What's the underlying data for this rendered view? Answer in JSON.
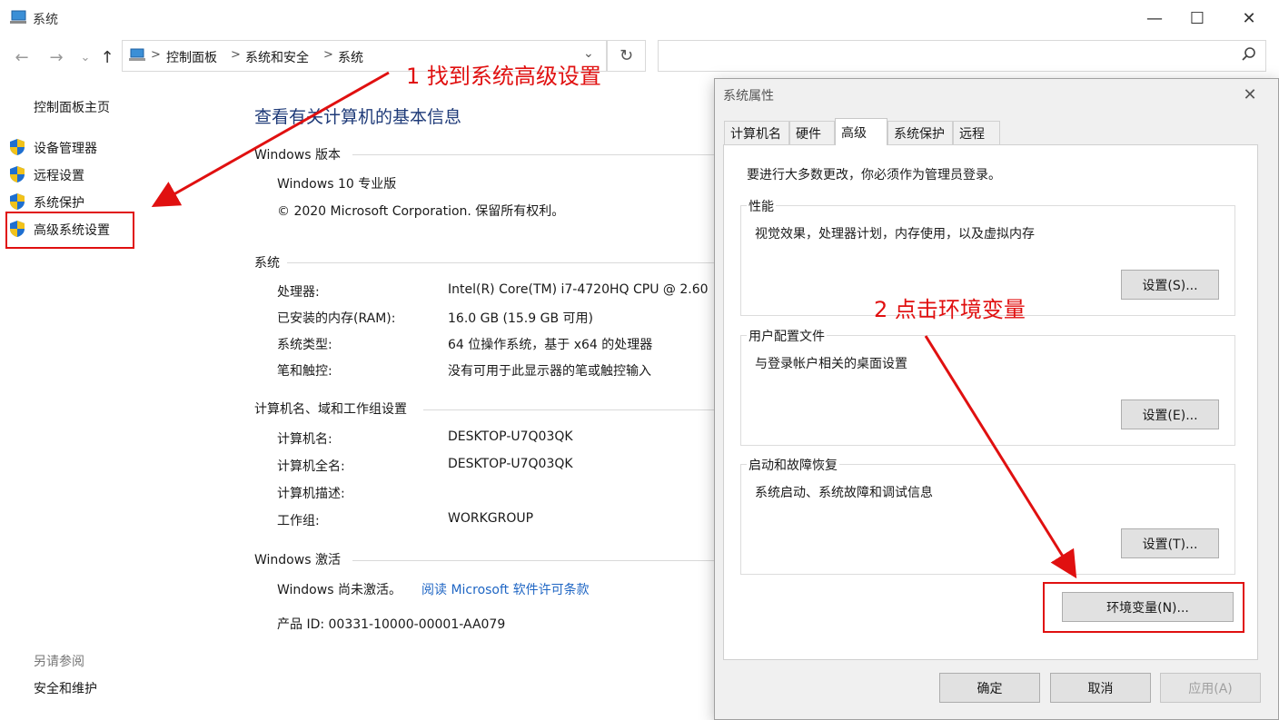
{
  "window": {
    "title": "系统",
    "controls": [
      "—",
      "☐",
      "✕"
    ]
  },
  "nav": {
    "back": "←",
    "forward": "→",
    "dropdown": "⌄",
    "up": "↑"
  },
  "breadcrumb": [
    "控制面板",
    "系统和安全",
    "系统"
  ],
  "breadcrumb_sep": ">",
  "address_dropdown": "⌄",
  "refresh": "↻",
  "sidebar": {
    "home": "控制面板主页",
    "items": [
      "设备管理器",
      "远程设置",
      "系统保护",
      "高级系统设置"
    ],
    "see_also_label": "另请参阅",
    "see_also": [
      "安全和维护"
    ]
  },
  "main": {
    "heading": "查看有关计算机的基本信息",
    "windows_edition": {
      "title": "Windows 版本",
      "edition": "Windows 10 专业版",
      "copyright": "© 2020 Microsoft Corporation. 保留所有权利。"
    },
    "system": {
      "title": "系统",
      "rows": [
        {
          "label": "处理器:",
          "value": "Intel(R) Core(TM) i7-4720HQ CPU @ 2.60"
        },
        {
          "label": "已安装的内存(RAM):",
          "value": "16.0 GB (15.9 GB 可用)"
        },
        {
          "label": "系统类型:",
          "value": "64 位操作系统，基于 x64 的处理器"
        },
        {
          "label": "笔和触控:",
          "value": "没有可用于此显示器的笔或触控输入"
        }
      ]
    },
    "computer": {
      "title": "计算机名、域和工作组设置",
      "rows": [
        {
          "label": "计算机名:",
          "value": "DESKTOP-U7Q03QK"
        },
        {
          "label": "计算机全名:",
          "value": "DESKTOP-U7Q03QK"
        },
        {
          "label": "计算机描述:",
          "value": ""
        },
        {
          "label": "工作组:",
          "value": "WORKGROUP"
        }
      ]
    },
    "activation": {
      "title": "Windows 激活",
      "status": "Windows 尚未激活。",
      "link": "阅读 Microsoft 软件许可条款",
      "product_id": "产品 ID: 00331-10000-00001-AA079"
    }
  },
  "dialog": {
    "title": "系统属性",
    "close": "✕",
    "tabs": [
      "计算机名",
      "硬件",
      "高级",
      "系统保护",
      "远程"
    ],
    "active_tab": "高级",
    "admin_note": "要进行大多数更改，你必须作为管理员登录。",
    "groups": [
      {
        "title": "性能",
        "desc": "视觉效果，处理器计划，内存使用，以及虚拟内存",
        "button": "设置(S)..."
      },
      {
        "title": "用户配置文件",
        "desc": "与登录帐户相关的桌面设置",
        "button": "设置(E)..."
      },
      {
        "title": "启动和故障恢复",
        "desc": "系统启动、系统故障和调试信息",
        "button": "设置(T)..."
      }
    ],
    "env_button": "环境变量(N)...",
    "ok": "确定",
    "cancel": "取消",
    "apply": "应用(A)"
  },
  "annotations": {
    "step1": "1 找到系统高级设置",
    "step2": "2 点击环境变量",
    "color": "#e01010"
  },
  "icons": [
    "system-icon",
    "shield-icon",
    "search-icon",
    "refresh-icon",
    "back-arrow-icon",
    "forward-arrow-icon",
    "up-arrow-icon"
  ]
}
